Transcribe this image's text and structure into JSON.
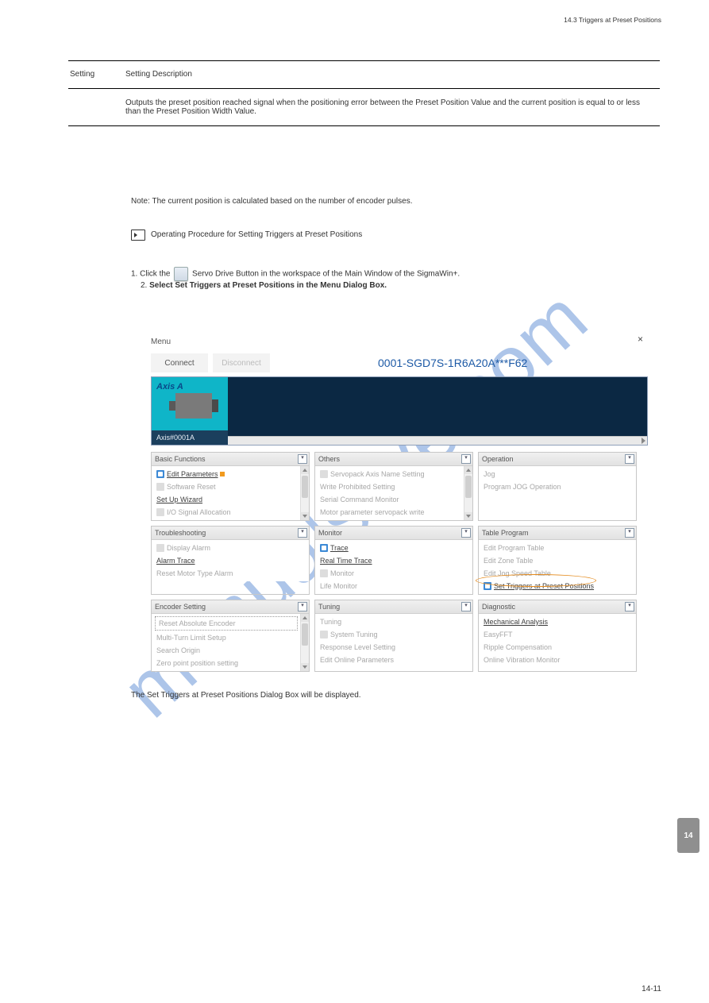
{
  "header": {
    "breadcrumb": "14.3 Triggers at Preset Positions",
    "page_number": "14-11",
    "sidebar": "14"
  },
  "setting_table": {
    "row1_left": "Setting",
    "row1_right": "Setting Description",
    "row2_right": "Outputs the preset position reached signal when the positioning error between the Preset Position Value and the current position is equal to or less than the Preset Position Width Value."
  },
  "notes": {
    "note_line1": "Note: The current position is calculated based on the number of encoder pulses.",
    "op_proc": "Operating Procedure for Setting Triggers at Preset Positions",
    "step1a": "Click the",
    "step1b": "Servo Drive Button in the workspace of the Main Window of the SigmaWin+.",
    "step2": "Select Set Triggers at Preset Positions in the Menu Dialog Box.",
    "step3": "The Set Triggers at Preset Positions Dialog Box will be displayed."
  },
  "screenshot": {
    "menu_label": "Menu",
    "close": "×",
    "connect": "Connect",
    "disconnect": "Disconnect",
    "model": "0001-SGD7S-1R6A20A***F62",
    "axis_label": "Axis A",
    "axis_id": "Axis#0001A",
    "panels": {
      "basic": {
        "title": "Basic Functions",
        "items": [
          "Edit Parameters",
          "Software Reset",
          "Set Up Wizard",
          "I/O Signal Allocation"
        ]
      },
      "others": {
        "title": "Others",
        "items": [
          "Servopack Axis Name Setting",
          "Write Prohibited Setting",
          "Serial Command Monitor",
          "Motor parameter servopack write"
        ]
      },
      "oper": {
        "title": "Operation",
        "items": [
          "Jog",
          "Program JOG Operation"
        ]
      },
      "trouble": {
        "title": "Troubleshooting",
        "items": [
          "Display Alarm",
          "Alarm Trace",
          "Reset Motor Type Alarm"
        ]
      },
      "monitor": {
        "title": "Monitor",
        "items": [
          "Trace",
          "Real Time Trace",
          "Monitor",
          "Life Monitor"
        ]
      },
      "tablep": {
        "title": "Table Program",
        "items": [
          "Edit Program Table",
          "Edit Zone Table",
          "Edit Jog Speed Table",
          "Set Triggers at Preset Positions"
        ]
      },
      "encoder": {
        "title": "Encoder Setting",
        "items": [
          "Reset Absolute Encoder",
          "Multi-Turn Limit Setup",
          "Search Origin",
          "Zero point position setting"
        ]
      },
      "tuning": {
        "title": "Tuning",
        "items": [
          "Tuning",
          "System Tuning",
          "Response Level Setting",
          "Edit Online Parameters"
        ]
      },
      "diag": {
        "title": "Diagnostic",
        "items": [
          "Mechanical Analysis",
          "EasyFFT",
          "Ripple Compensation",
          "Online Vibration Monitor"
        ]
      }
    }
  },
  "watermark": "manualslive.com"
}
